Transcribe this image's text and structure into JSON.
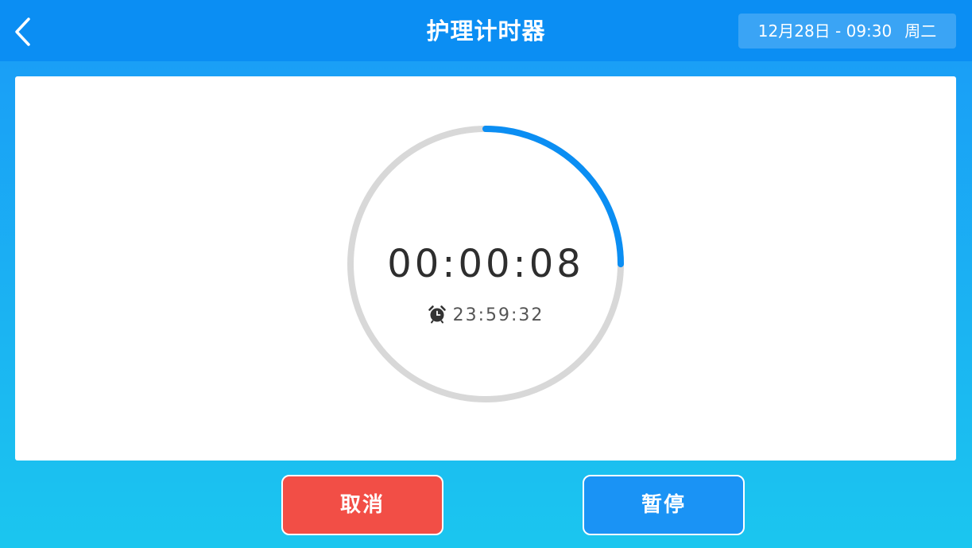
{
  "header": {
    "title": "护理计时器",
    "back_icon": "chevron-left-icon",
    "date": "12月28日 - 09:30",
    "weekday": "周二"
  },
  "timer": {
    "elapsed": "00:00:08",
    "remaining": "23:59:32",
    "alarm_icon": "alarm-clock-icon",
    "progress_fraction": 0.25,
    "track_color": "#d8d8d8",
    "progress_color": "#0b8ef3"
  },
  "actions": {
    "cancel_label": "取消",
    "pause_label": "暂停",
    "cancel_color": "#f24e46",
    "pause_color": "#1a93f5"
  }
}
